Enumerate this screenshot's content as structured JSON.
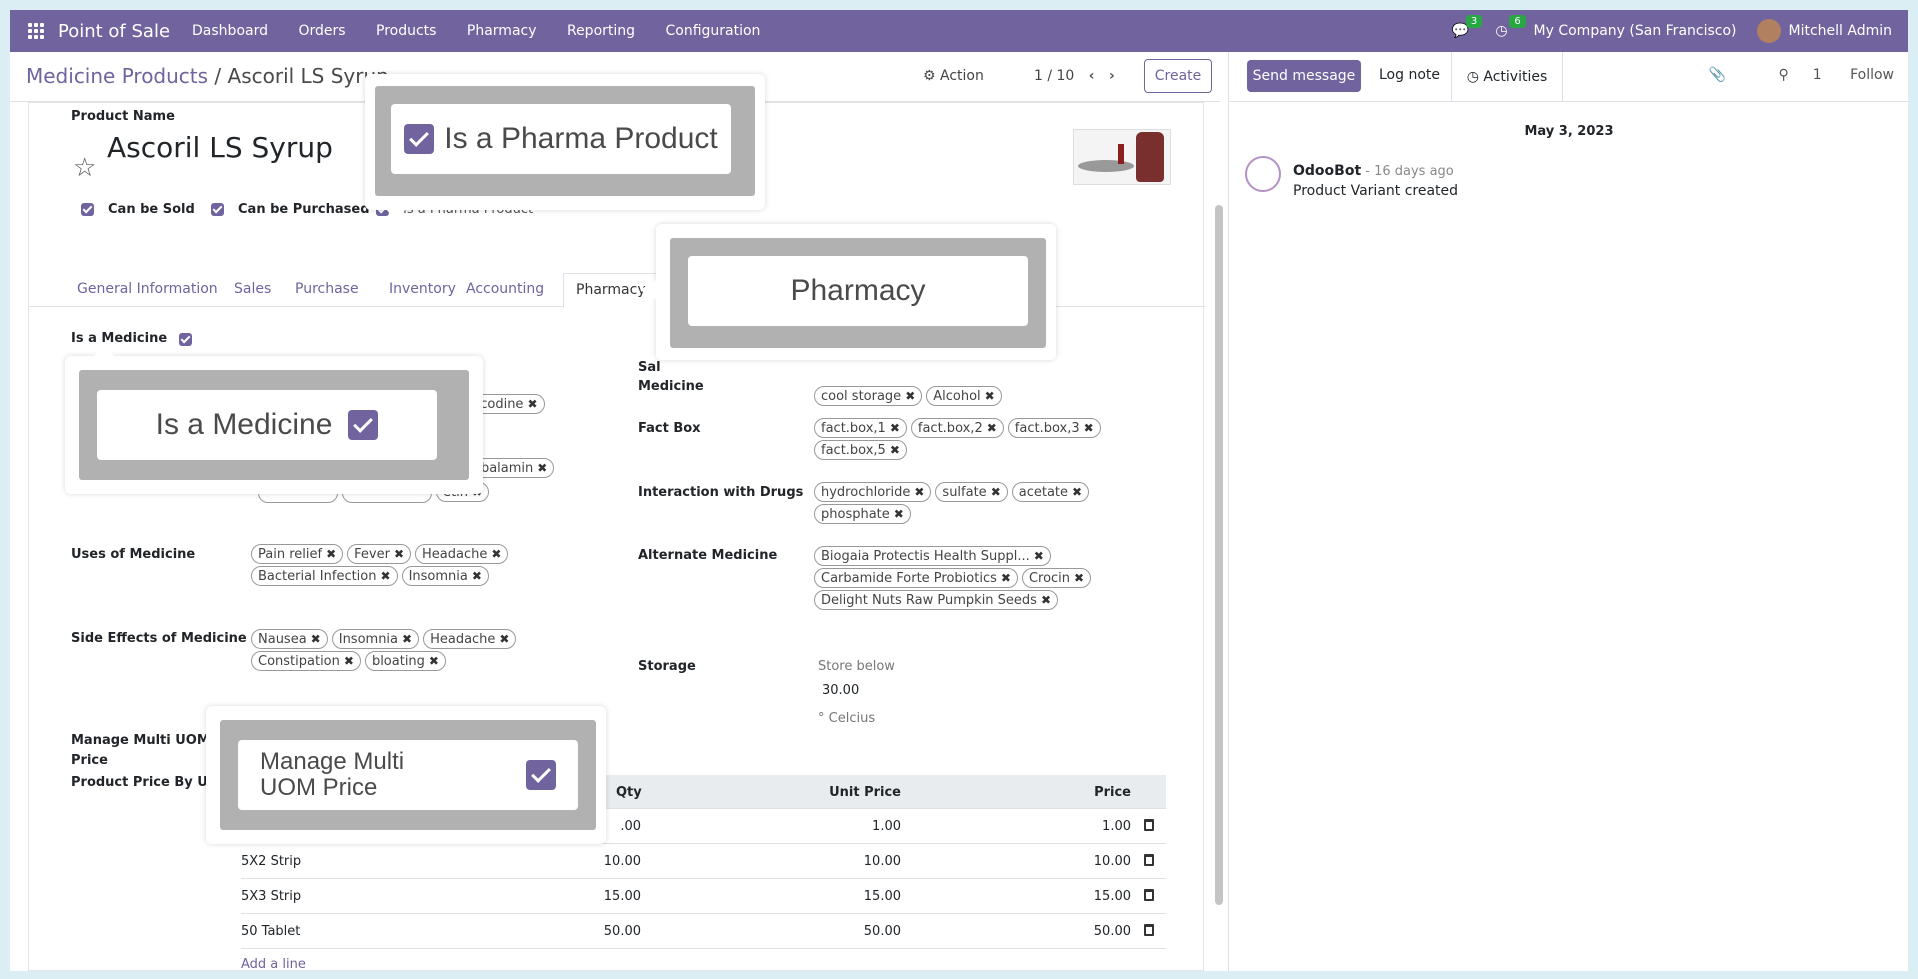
{
  "navbar": {
    "app_name": "Point of Sale",
    "menu": [
      "Dashboard",
      "Orders",
      "Products",
      "Pharmacy",
      "Reporting",
      "Configuration"
    ],
    "messages_count": "3",
    "activities_count": "6",
    "company": "My Company (San Francisco)",
    "user": "Mitchell Admin"
  },
  "control_panel": {
    "breadcrumb_parent": "Medicine Products",
    "breadcrumb_sep": " / ",
    "breadcrumb_current": "Ascoril LS Syrup",
    "action": "Action",
    "pager": "1 / 10",
    "create": "Create"
  },
  "chatter": {
    "send_message": "Send message",
    "log_note": "Log note",
    "activities": "Activities",
    "followers_count": "1",
    "follow": "Follow",
    "date": "May 3, 2023",
    "author": "OdooBot",
    "time": " - 16 days ago",
    "message": "Product Variant created"
  },
  "form": {
    "product_name_label": "Product Name",
    "product_name": "Ascoril LS Syrup",
    "can_be_sold": "Can be Sold",
    "can_be_purchased": "Can be Purchased",
    "is_pharma_product": "Is a Pharma Product",
    "tabs": [
      "General Information",
      "Sales",
      "Purchase",
      "Inventory",
      "Accounting",
      "Pharmacy"
    ],
    "is_medicine_label": "Is a Medicine",
    "salt_medicine_label_top": "Sal",
    "salt_medicine_label": "Medicine",
    "salt_tags_row2": [
      "cool storage",
      "Alcohol"
    ],
    "partial_tag": "licodine",
    "partial_tag2": "obalamin",
    "partial_tag3": "etin",
    "fact_box_label": "Fact Box",
    "fact_box_tags": [
      "fact.box,1",
      "fact.box,2",
      "fact.box,3",
      "fact.box,5"
    ],
    "interaction_label": "Interaction with Drugs",
    "interaction_tags": [
      "hydrochloride",
      "sulfate",
      "acetate",
      "phosphate"
    ],
    "uses_label": "Uses of Medicine",
    "uses_tags": [
      "Pain relief",
      "Fever",
      "Headache",
      "Bacterial Infection",
      "Insomnia"
    ],
    "alternate_label": "Alternate Medicine",
    "alternate_tags": [
      "Biogaia Protectis Health Suppl...",
      "Carbamide Forte Probiotics",
      "Crocin",
      "Delight Nuts Raw Pumpkin Seeds"
    ],
    "side_effects_label": "Side Effects of Medicine",
    "side_effects_tags": [
      "Nausea",
      "Insomnia",
      "Headache",
      "Constipation",
      "bloating"
    ],
    "storage_label": "Storage",
    "store_below": "Store below",
    "storage_value": "30.00",
    "storage_unit": "° Celcius",
    "multi_uom_label_1": "Manage Multi UOM",
    "multi_uom_label_2": "Price",
    "price_by_uom_label": "Product Price By UOM",
    "uom_table": {
      "headers": [
        "Qty",
        "Unit Price",
        "Price"
      ],
      "rows": [
        {
          "uom": "",
          "qty": ".00",
          "unit_price": "1.00",
          "price": "1.00"
        },
        {
          "uom": "5X2 Strip",
          "qty": "10.00",
          "unit_price": "10.00",
          "price": "10.00"
        },
        {
          "uom": "5X3 Strip",
          "qty": "15.00",
          "unit_price": "15.00",
          "price": "15.00"
        },
        {
          "uom": "50 Tablet",
          "qty": "50.00",
          "unit_price": "50.00",
          "price": "50.00"
        }
      ],
      "add_line": "Add a line"
    }
  },
  "tooltips": {
    "pharma": "Is a Pharma Product",
    "pharmacy": "Pharmacy",
    "medicine": "Is a Medicine",
    "uom_1": "Manage Multi",
    "uom_2": "UOM Price"
  },
  "colors": {
    "primary": "#71639e",
    "badge": "#28a745",
    "background": "#dbeef4"
  }
}
